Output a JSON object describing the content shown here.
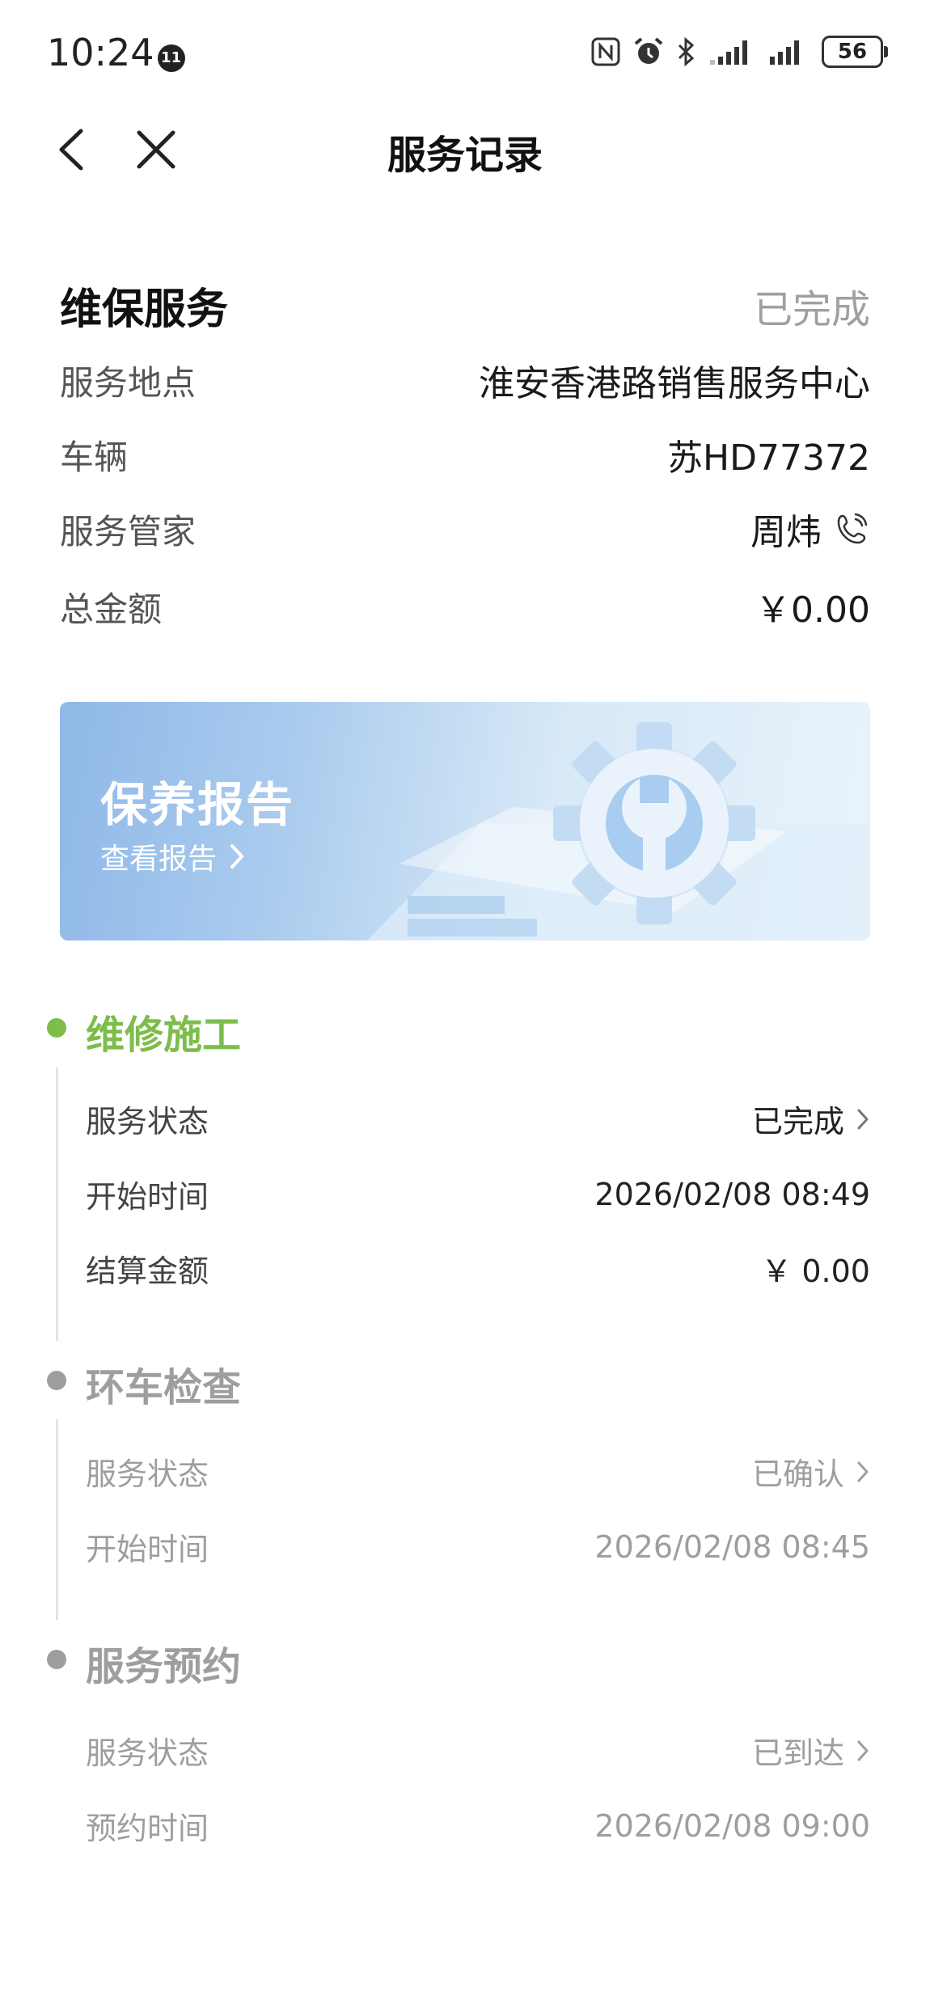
{
  "status_bar": {
    "time": "10:24",
    "time_badge": "11",
    "battery": "56"
  },
  "nav": {
    "title": "服务记录"
  },
  "summary": {
    "title": "维保服务",
    "status": "已完成",
    "rows": [
      {
        "label": "服务地点",
        "value": "淮安香港路销售服务中心"
      },
      {
        "label": "车辆",
        "value": "苏HD77372"
      },
      {
        "label": "服务管家",
        "value": "周炜"
      },
      {
        "label": "总金额",
        "value": "￥0.00"
      }
    ]
  },
  "banner": {
    "title": "保养报告",
    "link": "查看报告"
  },
  "timeline": [
    {
      "title": "维修施工",
      "rows": [
        {
          "label": "服务状态",
          "value": "已完成"
        },
        {
          "label": "开始时间",
          "value": "2026/02/08 08:49"
        },
        {
          "label": "结算金额",
          "value": "￥ 0.00"
        }
      ]
    },
    {
      "title": "环车检查",
      "rows": [
        {
          "label": "服务状态",
          "value": "已确认"
        },
        {
          "label": "开始时间",
          "value": "2026/02/08 08:45"
        }
      ]
    },
    {
      "title": "服务预约",
      "rows": [
        {
          "label": "服务状态",
          "value": "已到达"
        },
        {
          "label": "预约时间",
          "value": "2026/02/08 09:00"
        }
      ]
    }
  ],
  "colors": {
    "active": "#7dbd4a",
    "inactive": "#9e9e9e",
    "line": "#e3e3e3"
  }
}
